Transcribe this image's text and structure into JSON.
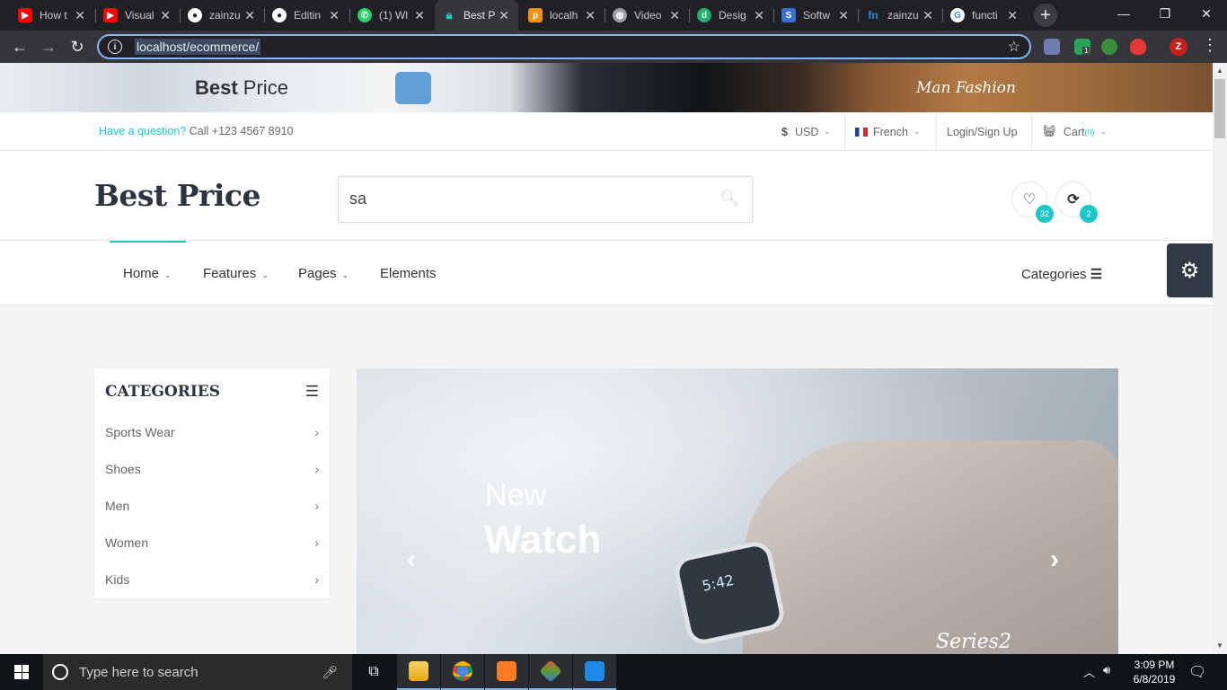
{
  "browser": {
    "tabs": [
      {
        "title": "How t",
        "favicon": "youtube-icon",
        "color": "#ff0000"
      },
      {
        "title": "Visual",
        "favicon": "youtube-icon",
        "color": "#ff0000"
      },
      {
        "title": "zainzu",
        "favicon": "github-icon",
        "color": "#ffffff"
      },
      {
        "title": "Editin",
        "favicon": "github-icon",
        "color": "#ffffff"
      },
      {
        "title": "(1) Wl",
        "favicon": "whatsapp-icon",
        "color": "#25d366"
      },
      {
        "title": "Best P",
        "favicon": "lock-icon",
        "color": "#1cc7c8"
      },
      {
        "title": "localh",
        "favicon": "phpmyadmin-icon",
        "color": "#f29111"
      },
      {
        "title": "Video",
        "favicon": "globe-icon",
        "color": "#9aa0a6"
      },
      {
        "title": "Desig",
        "favicon": "design-icon",
        "color": "#1fb26b"
      },
      {
        "title": "Softw",
        "favicon": "software-icon",
        "color": "#3b6fd8"
      },
      {
        "title": "zainzu",
        "favicon": "fn-icon",
        "color": "#2a8bd6"
      },
      {
        "title": "functi",
        "favicon": "google-icon",
        "color": "#4285f4"
      }
    ],
    "url": "localhost/ecommerce/",
    "profile_initial": "Z",
    "extension_badge": "1"
  },
  "banner": {
    "brand_bold": "Best",
    "brand_rest": " Price",
    "script_text": "Man Fashion"
  },
  "topbar": {
    "question": "Have a question?",
    "call": " Call +123 4567 8910",
    "currency_symbol": "$",
    "currency": "USD",
    "language": "French",
    "login": "Login/Sign Up",
    "cart_label": "Cart",
    "cart_count": "(0)"
  },
  "header": {
    "logo": "Best Price",
    "search_value": "sa",
    "wishlist_count": "32",
    "compare_count": "2"
  },
  "nav": {
    "items": [
      "Home",
      "Features",
      "Pages",
      "Elements"
    ],
    "categories": "Categories"
  },
  "sidebar": {
    "title": "CATEGORIES",
    "items": [
      "Sports Wear",
      "Shoes",
      "Men",
      "Women",
      "Kids"
    ]
  },
  "slider": {
    "line1": "New",
    "line2": "Watch",
    "watermark": "Series2",
    "watch_time": "5:42"
  },
  "taskbar": {
    "search_placeholder": "Type here to search",
    "time": "3:09 PM",
    "date": "6/8/2019"
  },
  "colors": {
    "accent": "#1cc7c8",
    "dark": "#2c3440"
  }
}
